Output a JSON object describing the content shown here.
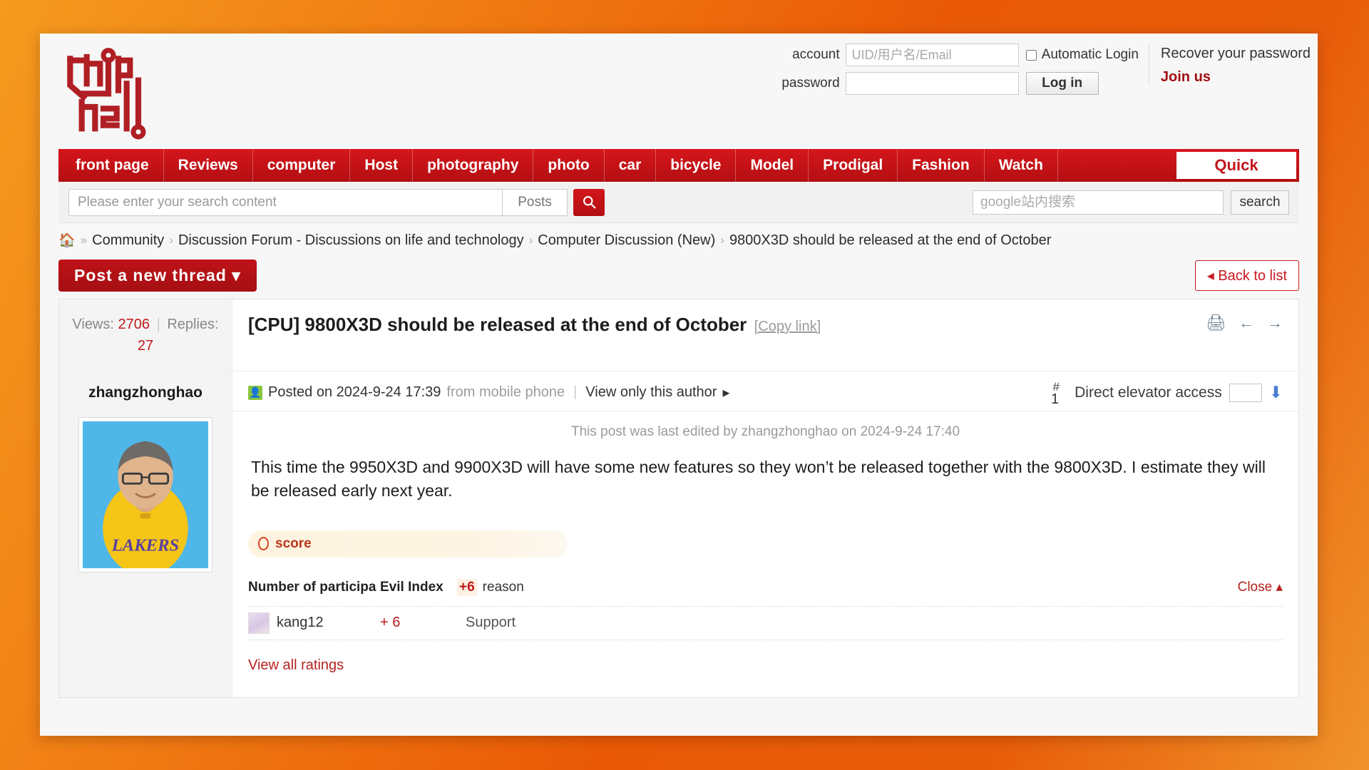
{
  "site": {
    "logo_alt": "chiphell-logo"
  },
  "login": {
    "account_label": "account",
    "account_placeholder": "UID/用户名/Email",
    "password_label": "password",
    "password_placeholder": "",
    "auto_login_label": "Automatic Login",
    "login_button": "Log in",
    "recover_link": "Recover your password",
    "join_link": "Join us"
  },
  "nav": {
    "items": [
      {
        "label": "front page"
      },
      {
        "label": "Reviews"
      },
      {
        "label": "computer"
      },
      {
        "label": "Host"
      },
      {
        "label": "photography"
      },
      {
        "label": "photo"
      },
      {
        "label": "car"
      },
      {
        "label": "bicycle"
      },
      {
        "label": "Model"
      },
      {
        "label": "Prodigal"
      },
      {
        "label": "Fashion"
      },
      {
        "label": "Watch"
      }
    ],
    "quick_label": "Quick"
  },
  "search": {
    "placeholder": "Please enter your search content",
    "scope": "Posts",
    "google_placeholder": "google站内搜索",
    "google_button": "search"
  },
  "breadcrumb": {
    "items": [
      {
        "label": "Community"
      },
      {
        "label": "Discussion Forum - Discussions on life and technology"
      },
      {
        "label": "Computer Discussion (New)"
      },
      {
        "label": "9800X3D should be released at the end of October"
      }
    ]
  },
  "actions": {
    "post_new": "Post a new thread",
    "back_to_list": "Back to list"
  },
  "thread": {
    "views_label": "Views:",
    "views_count": "2706",
    "replies_label": "Replies:",
    "replies_count": "27",
    "title": "[CPU] 9800X3D should be released at the end of October",
    "copy_link": "[Copy link]"
  },
  "post": {
    "author": "zhangzhonghao",
    "posted_label": "Posted on 2024-9-24 17:39",
    "source": "from mobile phone",
    "view_only_author": "View only this author",
    "floor_hash": "#",
    "floor_number": "1",
    "elevator_label": "Direct elevator access",
    "edit_note": "This post was last edited by zhangzhonghao on 2024-9-24 17:40",
    "body": "This time the 9950X3D and 9900X3D will have some new features so they won’t be released together with the 9800X3D. I estimate they will be released early next year."
  },
  "score": {
    "pill_label": "score",
    "header_participants": "Number of participa",
    "header_evil_index": "Evil Index",
    "header_delta": "+6",
    "header_reason": "reason",
    "close_label": "Close",
    "rows": [
      {
        "user": "kang12",
        "score": "+ 6",
        "reason": "Support"
      }
    ],
    "view_all": "View all ratings"
  },
  "colors": {
    "brand_red": "#c1181d",
    "page_bg_orange": "#ea5a06",
    "accent_green": "#8bc53f",
    "link_blue": "#4a7fd1"
  }
}
